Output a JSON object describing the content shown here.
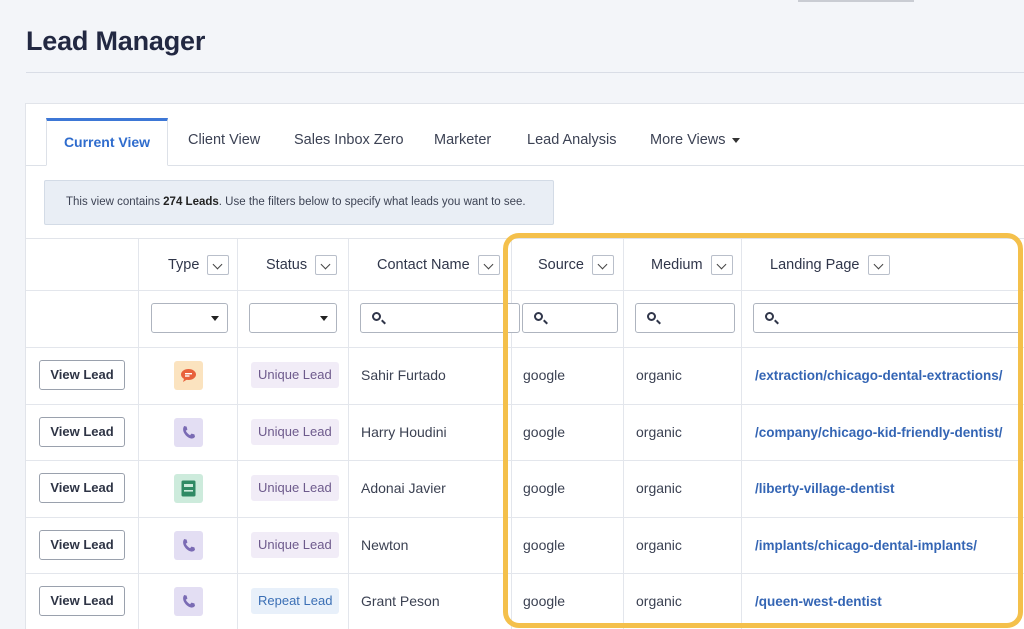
{
  "page": {
    "title": "Lead Manager"
  },
  "tabs": [
    {
      "label": "Current View"
    },
    {
      "label": "Client View"
    },
    {
      "label": "Sales Inbox Zero"
    },
    {
      "label": "Marketer"
    },
    {
      "label": "Lead Analysis"
    },
    {
      "label": "More Views"
    }
  ],
  "info": {
    "prefix": "This view contains ",
    "count": "274 Leads",
    "suffix": ". Use the filters below to specify what leads you want to see."
  },
  "columns": {
    "type": "Type",
    "status": "Status",
    "contact": "Contact Name",
    "source": "Source",
    "medium": "Medium",
    "landing": "Landing Page"
  },
  "rows": [
    {
      "button": "View Lead",
      "type_icon": "chat-icon",
      "status": "Unique Lead",
      "status_kind": "unique",
      "contact": "Sahir Furtado",
      "source": "google",
      "medium": "organic",
      "landing": "/extraction/chicago-dental-extractions/"
    },
    {
      "button": "View Lead",
      "type_icon": "phone-icon",
      "status": "Unique Lead",
      "status_kind": "unique",
      "contact": "Harry Houdini",
      "source": "google",
      "medium": "organic",
      "landing": "/company/chicago-kid-friendly-dentist/"
    },
    {
      "button": "View Lead",
      "type_icon": "form-icon",
      "status": "Unique Lead",
      "status_kind": "unique",
      "contact": "Adonai Javier",
      "source": "google",
      "medium": "organic",
      "landing": "/liberty-village-dentist"
    },
    {
      "button": "View Lead",
      "type_icon": "phone-icon",
      "status": "Unique Lead",
      "status_kind": "unique",
      "contact": "Newton",
      "source": "google",
      "medium": "organic",
      "landing": "/implants/chicago-dental-implants/"
    },
    {
      "button": "View Lead",
      "type_icon": "phone-icon",
      "status": "Repeat Lead",
      "status_kind": "repeat",
      "contact": "Grant Peson",
      "source": "google",
      "medium": "organic",
      "landing": "/queen-west-dentist"
    }
  ],
  "colors": {
    "accent": "#3d77d6",
    "highlight": "#f4c04b",
    "chat_bg": "#fbe3bf",
    "chat_fg": "#e8613c",
    "phone_bg": "#e3def3",
    "phone_fg": "#7a6bb4",
    "form_bg": "#cdebdc",
    "form_fg": "#2f8a64"
  }
}
